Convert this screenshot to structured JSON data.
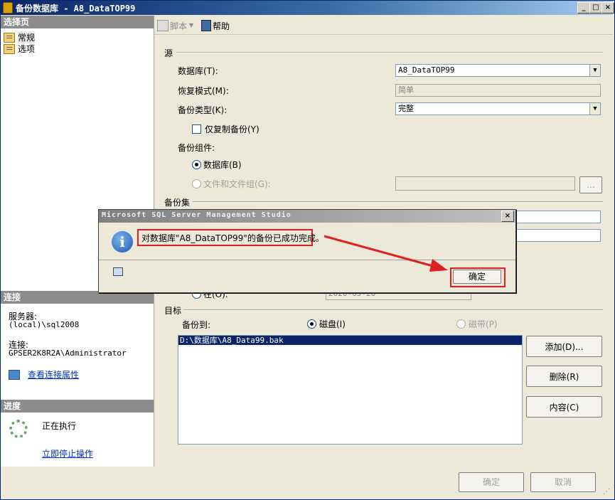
{
  "window": {
    "title": "备份数据库 - A8_DataTOP99",
    "min_label": "_",
    "max_label": "□",
    "close_label": "×"
  },
  "sidebar": {
    "select_page_header": "选择页",
    "pages": [
      {
        "label": "常规",
        "icon": "page-icon"
      },
      {
        "label": "选项",
        "icon": "page-icon"
      }
    ],
    "connection_header": "连接",
    "server_label": "服务器:",
    "server_value": "(local)\\sql2008",
    "connection_label": "连接:",
    "connection_value": "GPSER2K8R2A\\Administrator",
    "view_props_link": "查看连接属性",
    "progress_header": "进度",
    "progress_status": "正在执行",
    "stop_link": "立即停止操作"
  },
  "toolbar": {
    "script_label": "脚本",
    "help_label": "帮助"
  },
  "source": {
    "group_label": "源",
    "database_label": "数据库(T):",
    "database_value": "A8_DataTOP99",
    "recovery_label": "恢复模式(M):",
    "recovery_value": "简单",
    "backup_type_label": "备份类型(K):",
    "backup_type_value": "完整",
    "copy_only_label": "仅复制备份(Y)",
    "component_label": "备份组件:",
    "component_db_label": "数据库(B)",
    "component_files_label": "文件和文件组(G):",
    "browse_label": "..."
  },
  "backup_set": {
    "group_label": "备份集",
    "expire_on_label": "在(O):",
    "expire_on_value": "2020-05-20"
  },
  "destination": {
    "group_label": "目标",
    "backup_to_label": "备份到:",
    "disk_label": "磁盘(I)",
    "tape_label": "磁带(P)",
    "files": [
      "D:\\数据库\\A8_Data99.bak"
    ],
    "add_button": "添加(D)...",
    "remove_button": "删除(R)",
    "contents_button": "内容(C)"
  },
  "footer": {
    "ok_button": "确定",
    "cancel_button": "取消"
  },
  "dialog": {
    "title": "Microsoft SQL Server Management Studio",
    "message": "对数据库\"A8_DataTOP99\"的备份已成功完成。",
    "ok_button": "确定",
    "close_label": "×"
  },
  "colors": {
    "highlight_red": "#e02020",
    "selection_blue": "#0a246a"
  }
}
